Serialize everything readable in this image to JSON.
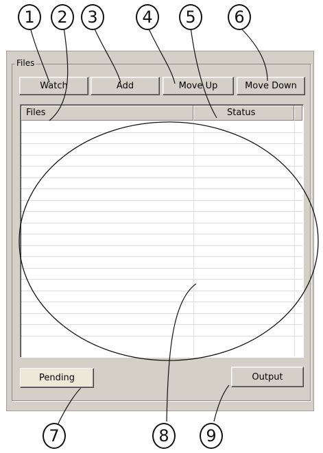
{
  "group": {
    "title": "Files"
  },
  "toolbar": {
    "watch_label": "Watch",
    "add_label": "Add",
    "move_up_label": "Move Up",
    "move_down_label": "Move Down"
  },
  "list": {
    "columns": [
      "Files",
      "Status"
    ],
    "empty_row_count": 19
  },
  "footer": {
    "pending_label": "Pending",
    "output_label": "Output"
  },
  "callouts": [
    "1",
    "2",
    "3",
    "4",
    "5",
    "6",
    "7",
    "8",
    "9"
  ]
}
